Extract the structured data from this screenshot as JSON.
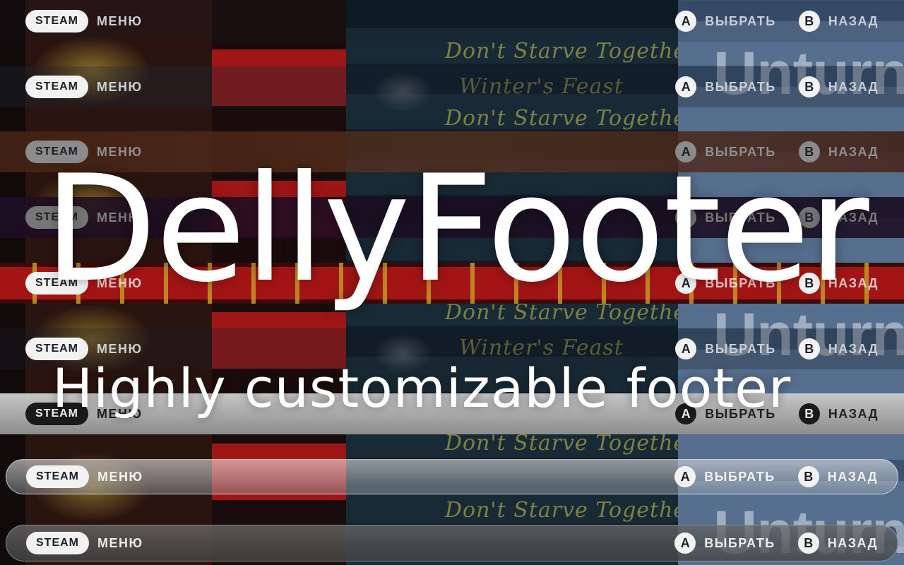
{
  "background": {
    "game_titles": [
      "Don't Starve Together",
      "Winter's Feast",
      "Unturned"
    ]
  },
  "headline": "DellyFooter",
  "subline": "Highly customizable footer",
  "footer": {
    "steam_label": "STEAM",
    "menu_label": "МЕНЮ",
    "select_key": "A",
    "select_label": "ВЫБРАТЬ",
    "back_key": "B",
    "back_label": "НАЗАД"
  },
  "footer_variants": [
    "default",
    "dark-blue",
    "wood",
    "purple",
    "winter-holiday",
    "default-dim",
    "light-gray",
    "glass",
    "dark-glass"
  ]
}
